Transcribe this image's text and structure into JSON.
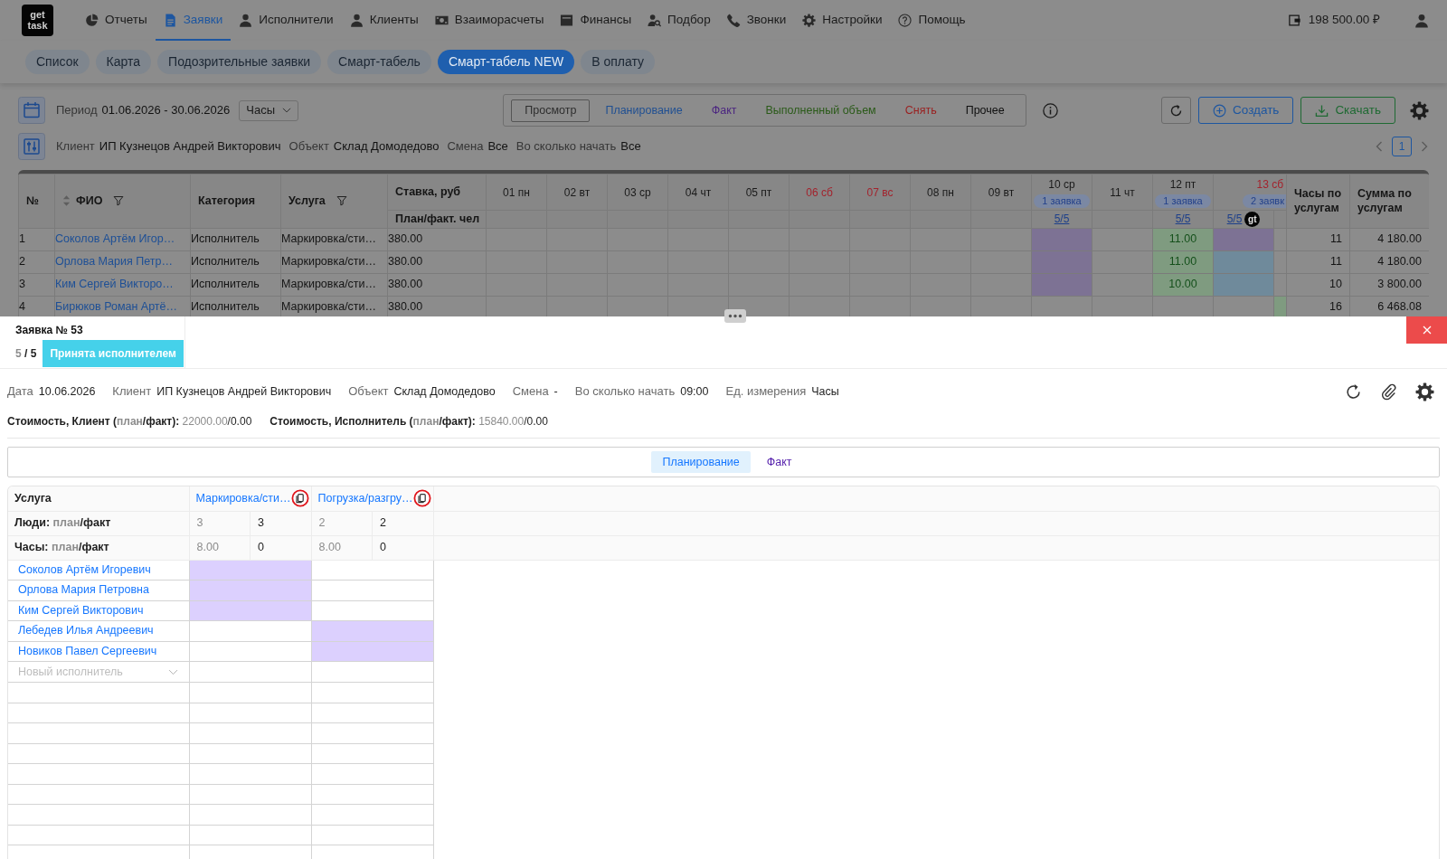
{
  "logo": "get task",
  "nav": [
    {
      "label": "Отчеты",
      "selected": false
    },
    {
      "label": "Заявки",
      "selected": true
    },
    {
      "label": "Исполнители",
      "selected": false
    },
    {
      "label": "Клиенты",
      "selected": false
    },
    {
      "label": "Взаиморасчеты",
      "selected": false
    },
    {
      "label": "Финансы",
      "selected": false
    },
    {
      "label": "Подбор",
      "selected": false
    },
    {
      "label": "Звонки",
      "selected": false
    },
    {
      "label": "Настройки",
      "selected": false
    },
    {
      "label": "Помощь",
      "selected": false
    }
  ],
  "balance": "198 500.00 ₽",
  "subnav": [
    {
      "label": "Список",
      "selected": false
    },
    {
      "label": "Карта",
      "selected": false
    },
    {
      "label": "Подозрительные заявки",
      "selected": false
    },
    {
      "label": "Смарт-табель",
      "selected": false
    },
    {
      "label": "Смарт-табель NEW",
      "selected": true
    },
    {
      "label": "В оплату",
      "selected": false
    }
  ],
  "toolbar": {
    "period": {
      "label": "Период",
      "value": "01.06.2026 - 30.06.2026"
    },
    "unit": "Часы",
    "modes": [
      {
        "label": "Просмотр",
        "kind": "view",
        "selected": true
      },
      {
        "label": "Планирование",
        "kind": "plan",
        "selected": false
      },
      {
        "label": "Факт",
        "kind": "fact",
        "selected": false
      },
      {
        "label": "Выполненный объем",
        "kind": "volume",
        "selected": false
      },
      {
        "label": "Снять",
        "kind": "remove",
        "selected": false
      },
      {
        "label": "Прочее",
        "kind": "other",
        "selected": false
      }
    ],
    "actions": [
      {
        "label": "Создать",
        "kind": "create"
      },
      {
        "label": "Скачать",
        "kind": "download"
      }
    ]
  },
  "filters": [
    {
      "label": "Клиент",
      "value": "ИП Кузнецов Андрей Викторович"
    },
    {
      "label": "Объект",
      "value": "Склад Домодедово"
    },
    {
      "label": "Смена",
      "value": "Все"
    },
    {
      "label": "Во сколько начать",
      "value": "Все"
    }
  ],
  "pagination": [
    {
      "label": "1",
      "selected": true
    }
  ],
  "table": {
    "columns": [
      {
        "label": "№",
        "sort": false,
        "filter": false
      },
      {
        "label": "ФИО",
        "sort": true,
        "filter": true
      },
      {
        "label": "Категория",
        "sort": false,
        "filter": false
      },
      {
        "label": "Услуга",
        "sort": false,
        "filter": true
      }
    ],
    "rate_column": {
      "label": "Ставка, руб",
      "sublabel": "План/факт. чел"
    },
    "days": [
      {
        "label": "01 пн",
        "weekend": false
      },
      {
        "label": "02 вт",
        "weekend": false
      },
      {
        "label": "03 ср",
        "weekend": false
      },
      {
        "label": "04 чт",
        "weekend": false
      },
      {
        "label": "05 пт",
        "weekend": false
      },
      {
        "label": "06 сб",
        "weekend": true
      },
      {
        "label": "07 вс",
        "weekend": true
      },
      {
        "label": "08 пн",
        "weekend": false
      },
      {
        "label": "09 вт",
        "weekend": false
      },
      {
        "label": "10 ср",
        "weekend": false,
        "badge": "1 заявка",
        "slots": [
          {
            "kind": "link",
            "text": "5/5"
          }
        ]
      },
      {
        "label": "11 чт",
        "weekend": false
      },
      {
        "label": "12 пт",
        "weekend": false,
        "badge": "1 заявка",
        "slots": [
          {
            "kind": "link",
            "text": "5/5"
          }
        ]
      },
      {
        "label": "13 сб",
        "weekend": true,
        "badge": "2 заявк",
        "slots": [
          {
            "kind": "link",
            "text": "5/5",
            "tag": "gt"
          },
          {
            "kind": "clipped"
          }
        ]
      }
    ],
    "total_columns": [
      "Часы по услугам",
      "Сумма по услугам"
    ],
    "rows": [
      {
        "num": "1",
        "name": "Соколов Артём Игор…",
        "category": "Исполнитель",
        "service": "Маркировка/сти…",
        "rate": "380.00",
        "cells": [
          {
            "kind": "empty"
          },
          {
            "kind": "empty"
          },
          {
            "kind": "empty"
          },
          {
            "kind": "empty"
          },
          {
            "kind": "empty"
          },
          {
            "kind": "empty"
          },
          {
            "kind": "empty"
          },
          {
            "kind": "empty"
          },
          {
            "kind": "empty"
          },
          {
            "kind": "planned"
          },
          {
            "kind": "empty"
          },
          {
            "kind": "worked",
            "value": "11.00"
          },
          {
            "kind": "planned"
          },
          {
            "kind": "empty"
          }
        ],
        "hours": "11",
        "sum": "4 180.00"
      },
      {
        "num": "2",
        "name": "Орлова Мария Петр…",
        "category": "Исполнитель",
        "service": "Маркировка/сти…",
        "rate": "380.00",
        "cells": [
          {
            "kind": "empty"
          },
          {
            "kind": "empty"
          },
          {
            "kind": "empty"
          },
          {
            "kind": "empty"
          },
          {
            "kind": "empty"
          },
          {
            "kind": "empty"
          },
          {
            "kind": "empty"
          },
          {
            "kind": "empty"
          },
          {
            "kind": "empty"
          },
          {
            "kind": "planned"
          },
          {
            "kind": "empty"
          },
          {
            "kind": "worked",
            "value": "11.00"
          },
          {
            "kind": "approved"
          },
          {
            "kind": "empty"
          }
        ],
        "hours": "11",
        "sum": "4 180.00"
      },
      {
        "num": "3",
        "name": "Ким Сергей Викторо…",
        "category": "Исполнитель",
        "service": "Маркировка/сти…",
        "rate": "380.00",
        "cells": [
          {
            "kind": "empty"
          },
          {
            "kind": "empty"
          },
          {
            "kind": "empty"
          },
          {
            "kind": "empty"
          },
          {
            "kind": "empty"
          },
          {
            "kind": "empty"
          },
          {
            "kind": "empty"
          },
          {
            "kind": "empty"
          },
          {
            "kind": "empty"
          },
          {
            "kind": "planned"
          },
          {
            "kind": "empty"
          },
          {
            "kind": "worked",
            "value": "10.00"
          },
          {
            "kind": "approved"
          },
          {
            "kind": "empty"
          }
        ],
        "hours": "10",
        "sum": "3 800.00"
      },
      {
        "num": "4",
        "name": "Бирюков Роман Артё…",
        "category": "Исполнитель",
        "service": "Маркировка/сти…",
        "rate": "380.00",
        "cells": [
          {
            "kind": "empty"
          },
          {
            "kind": "empty"
          },
          {
            "kind": "empty"
          },
          {
            "kind": "empty"
          },
          {
            "kind": "empty"
          },
          {
            "kind": "empty"
          },
          {
            "kind": "empty"
          },
          {
            "kind": "empty"
          },
          {
            "kind": "empty"
          },
          {
            "kind": "empty"
          },
          {
            "kind": "empty"
          },
          {
            "kind": "empty"
          },
          {
            "kind": "empty"
          },
          {
            "kind": "worked"
          }
        ],
        "hours": "16",
        "sum": "6 468.08"
      }
    ]
  },
  "request": {
    "title": "Заявка № 53",
    "count": [
      {
        "text": "5",
        "muted": true
      },
      {
        "text": " / 5",
        "muted": false
      }
    ],
    "status": "Принята исполнителем",
    "info": [
      {
        "label": "Дата",
        "value": "10.06.2026"
      },
      {
        "label": "Клиент",
        "value": "ИП Кузнецов Андрей Викторович"
      },
      {
        "label": "Объект",
        "value": "Склад Домодедово"
      },
      {
        "label": "Смена",
        "value": "-"
      },
      {
        "label": "Во сколько начать",
        "value": "09:00"
      },
      {
        "label": "Ед. измерения",
        "value": "Часы"
      }
    ],
    "costs": [
      {
        "label": [
          {
            "text": "Стоимость, Клиент (",
            "muted": false
          },
          {
            "text": "план",
            "muted": true
          },
          {
            "text": "/факт): ",
            "muted": false
          }
        ],
        "value": [
          {
            "text": "22000.00",
            "muted": true
          },
          {
            "text": "/0.00",
            "muted": false
          }
        ]
      },
      {
        "label": [
          {
            "text": "Стоимость, Исполнитель (",
            "muted": false
          },
          {
            "text": "план",
            "muted": true
          },
          {
            "text": "/факт): ",
            "muted": false
          }
        ],
        "value": [
          {
            "text": "15840.00",
            "muted": true
          },
          {
            "text": "/0.00",
            "muted": false
          }
        ]
      }
    ],
    "tabs": [
      {
        "label": "Планирование",
        "selected": true
      },
      {
        "label": "Факт",
        "selected": false
      }
    ],
    "grid": {
      "service_label": "Услуга",
      "people_label": [
        {
          "text": "Люди: ",
          "muted": false
        },
        {
          "text": "план",
          "muted": true
        },
        {
          "text": "/факт",
          "muted": false
        }
      ],
      "hours_label": [
        {
          "text": "Часы: ",
          "muted": false
        },
        {
          "text": "план",
          "muted": true
        },
        {
          "text": "/факт",
          "muted": false
        }
      ],
      "services": [
        {
          "name": "Маркировка/сти…",
          "people_plan": "3",
          "people_fact": "3",
          "hours_plan": "8.00",
          "hours_fact": "0"
        },
        {
          "name": "Погрузка/разгру…",
          "people_plan": "2",
          "people_fact": "2",
          "hours_plan": "8.00",
          "hours_fact": "0"
        }
      ],
      "workers": [
        {
          "name": "Соколов Артём Игоревич",
          "cells": [
            {
              "assigned": true
            },
            {
              "assigned": false
            }
          ]
        },
        {
          "name": "Орлова Мария Петровна",
          "cells": [
            {
              "assigned": true
            },
            {
              "assigned": false
            }
          ]
        },
        {
          "name": "Ким Сергей Викторович",
          "cells": [
            {
              "assigned": true
            },
            {
              "assigned": false
            }
          ]
        },
        {
          "name": "Лебедев Илья Андреевич",
          "cells": [
            {
              "assigned": false
            },
            {
              "assigned": true
            }
          ]
        },
        {
          "name": "Новиков Павел Сергеевич",
          "cells": [
            {
              "assigned": false
            },
            {
              "assigned": true
            }
          ]
        }
      ],
      "new_worker": {
        "placeholder": "Новый исполнитель"
      }
    }
  }
}
